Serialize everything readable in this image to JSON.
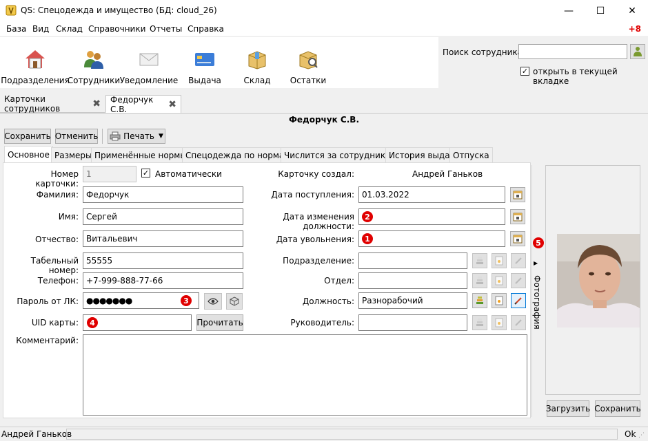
{
  "window": {
    "title": "QS: Спецодежда и имущество (БД: cloud_26)",
    "minimize": "—",
    "maximize": "☐",
    "close": "✕"
  },
  "menu": {
    "items": [
      "База",
      "Вид",
      "Склад",
      "Справочники",
      "Отчеты",
      "Справка"
    ],
    "badge": "+8"
  },
  "toolbar": {
    "buttons": [
      {
        "label": "Подразделения",
        "icon": "house-icon"
      },
      {
        "label": "Сотрудники",
        "icon": "people-icon"
      },
      {
        "label": "Уведомление",
        "icon": "envelope-icon"
      },
      {
        "label": "Выдача",
        "icon": "card-icon"
      },
      {
        "label": "Склад",
        "icon": "box-icon"
      },
      {
        "label": "Остатки",
        "icon": "box-search-icon"
      }
    ]
  },
  "search": {
    "label": "Поиск сотрудника:",
    "value": "",
    "open_in_tab_label": "открыть в текущей вкладке",
    "open_in_tab_checked": true
  },
  "doc_tabs": [
    {
      "label": "Карточки сотрудников"
    },
    {
      "label": "Федорчук С.В."
    }
  ],
  "person_title": "Федорчук С.В.",
  "actions": {
    "save": "Сохранить",
    "cancel": "Отменить",
    "print": "Печать"
  },
  "sub_tabs": [
    "Основное",
    "Размеры",
    "Применённые нормы",
    "Спецодежда по нормам",
    "Числится за сотрудником",
    "История выдач",
    "Отпуска"
  ],
  "form": {
    "card_number_label": "Номер карточки:",
    "card_number": "1",
    "auto_label": "Автоматически",
    "auto_checked": true,
    "surname_label": "Фамилия:",
    "surname": "Федорчук",
    "name_label": "Имя:",
    "name": "Сергей",
    "patronymic_label": "Отчество:",
    "patronymic": "Витальевич",
    "tab_number_label": "Табельный номер:",
    "tab_number": "55555",
    "phone_label": "Телефон:",
    "phone": "+7-999-888-77-66",
    "password_label": "Пароль от ЛК:",
    "password": "●●●●●●●",
    "uid_label": "UID карты:",
    "uid": "",
    "read_button": "Прочитать",
    "comment_label": "Комментарий:",
    "comment": "",
    "created_by_label": "Карточку создал:",
    "created_by": "Андрей Ганьков",
    "hire_date_label": "Дата поступления:",
    "hire_date": "01.03.2022",
    "position_change_label": "Дата изменения должности:",
    "position_change": "",
    "dismissal_label": "Дата увольнения:",
    "dismissal": "",
    "department_label": "Подразделение:",
    "department": "",
    "division_label": "Отдел:",
    "division": "",
    "position_label": "Должность:",
    "position": "Разнорабочий",
    "manager_label": "Руководитель:",
    "manager": ""
  },
  "badges": {
    "b1": "1",
    "b2": "2",
    "b3": "3",
    "b4": "4",
    "b5": "5"
  },
  "photo": {
    "vertical_label": "Фотография",
    "upload": "Загрузить",
    "save": "Сохранить"
  },
  "status": {
    "user": "Андрей Ганьков",
    "ok": "Ok"
  },
  "colors": {
    "badge": "#e00000",
    "accent": "#0078d7"
  }
}
